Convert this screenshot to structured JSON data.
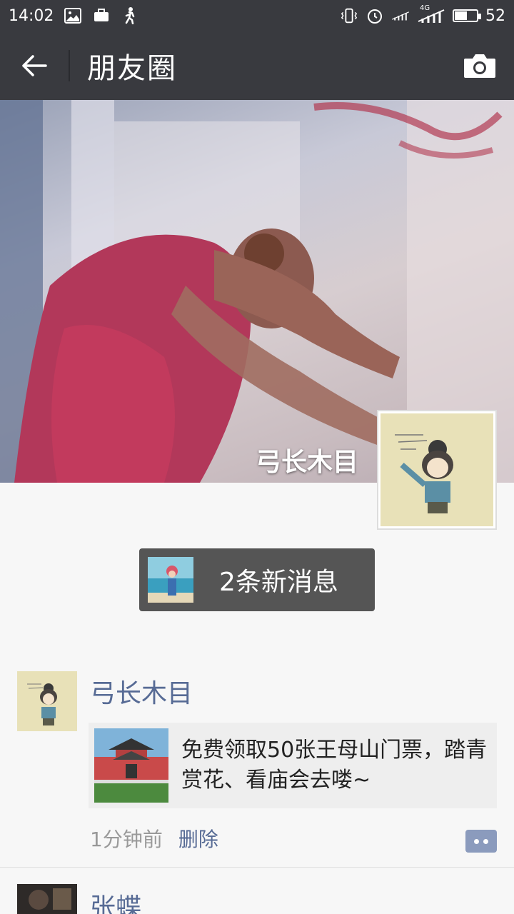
{
  "status_bar": {
    "time": "14:02",
    "battery": "52",
    "battery_level": 0.52,
    "network": "4G"
  },
  "nav": {
    "title": "朋友圈"
  },
  "cover": {
    "owner_name": "弓长木目"
  },
  "new_messages": {
    "label": "2条新消息"
  },
  "posts": [
    {
      "author": "弓长木目",
      "share_text": "免费领取50张王母山门票，踏青赏花、看庙会去喽~",
      "time": "1分钟前",
      "delete_label": "删除"
    },
    {
      "author": "张蝶"
    }
  ],
  "colors": {
    "header_bg": "#393a3f",
    "link": "#576b95",
    "new_msg_bg": "#555555"
  }
}
